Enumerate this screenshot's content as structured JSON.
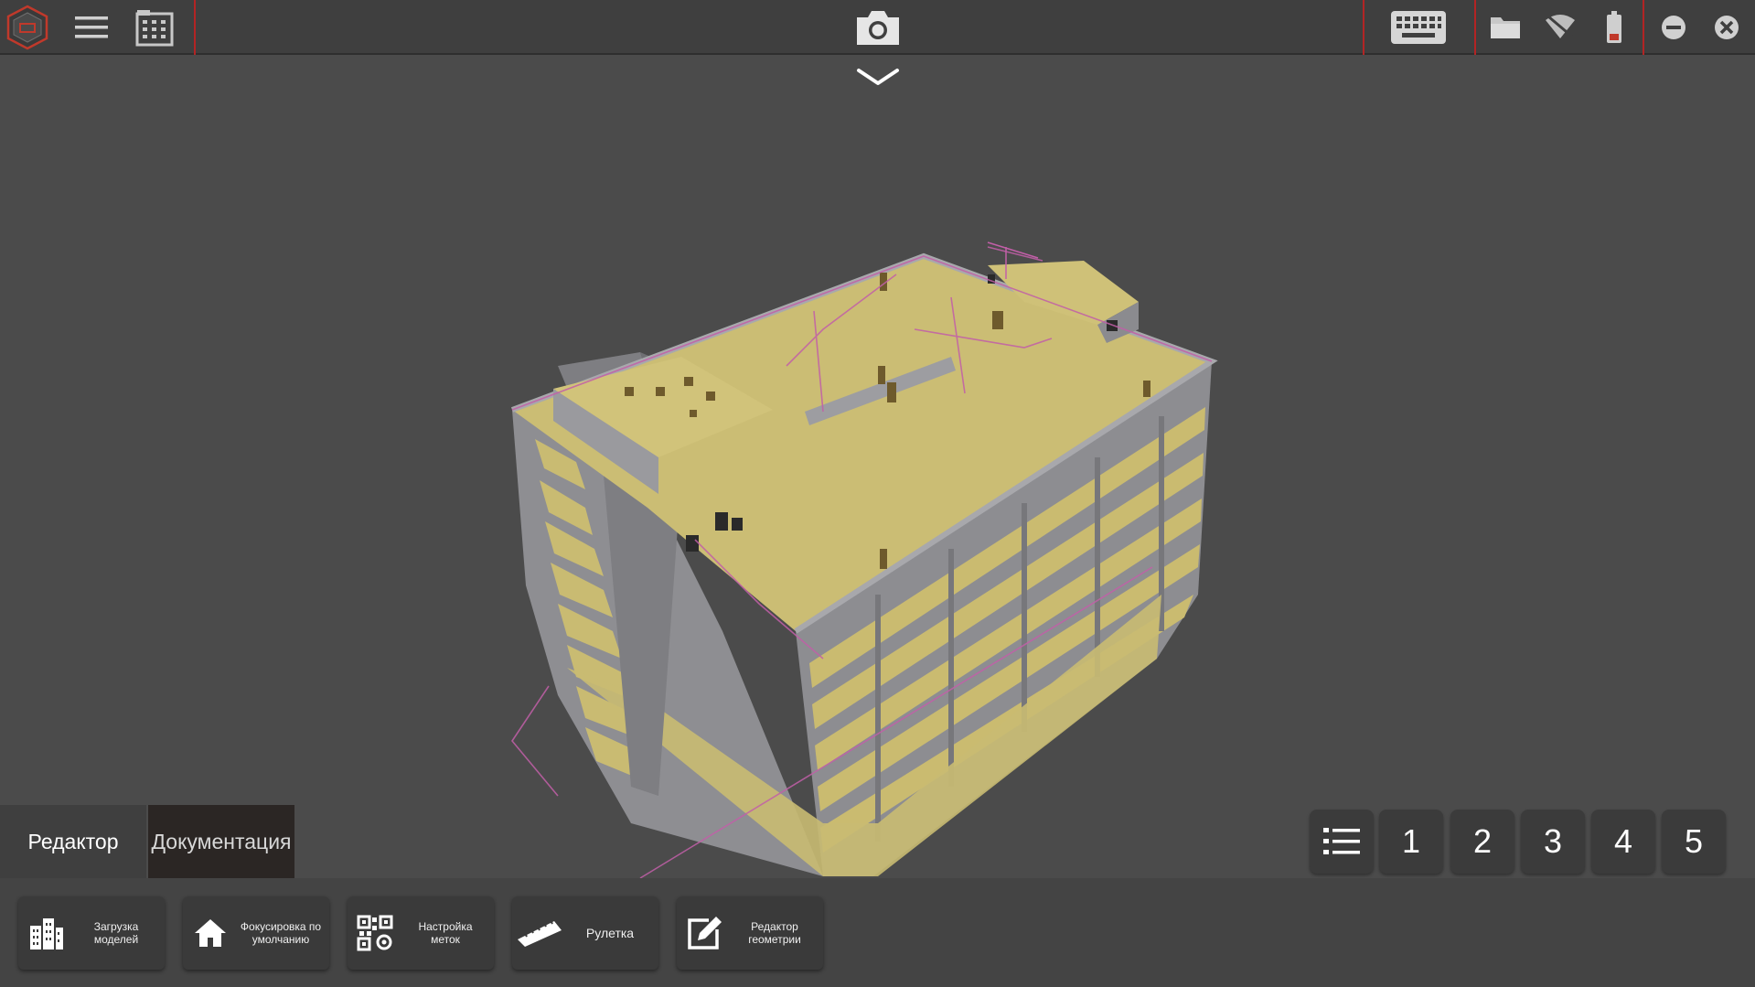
{
  "topbar": {
    "icons": {
      "logo": "app-logo-hexagon",
      "menu": "hamburger-menu-icon",
      "building": "building-icon",
      "camera": "camera-icon",
      "keyboard": "keyboard-icon",
      "folder": "folder-icon",
      "wifi": "wifi-off-icon",
      "battery": "battery-low-icon",
      "minimize": "minimize-icon",
      "close": "close-icon"
    },
    "accent_color": "#b32424"
  },
  "viewport": {
    "chevron": "chevron-down-icon",
    "model_colors": {
      "roof": "#cbbd74",
      "walls": "#8c8c8f",
      "outline": "#c25fa8",
      "background": "#4b4b4b"
    }
  },
  "tabs": {
    "editor": "Редактор",
    "docs": "Документация"
  },
  "view_buttons": {
    "list_icon": "list-icon",
    "labels": [
      "1",
      "2",
      "3",
      "4",
      "5"
    ]
  },
  "toolbar": {
    "load_models": "Загрузка моделей",
    "default_focus": "Фокусировка по умолчанию",
    "marker_settings": "Настройка меток",
    "tape_measure": "Рулетка",
    "geometry_editor": "Редактор геометрии"
  }
}
